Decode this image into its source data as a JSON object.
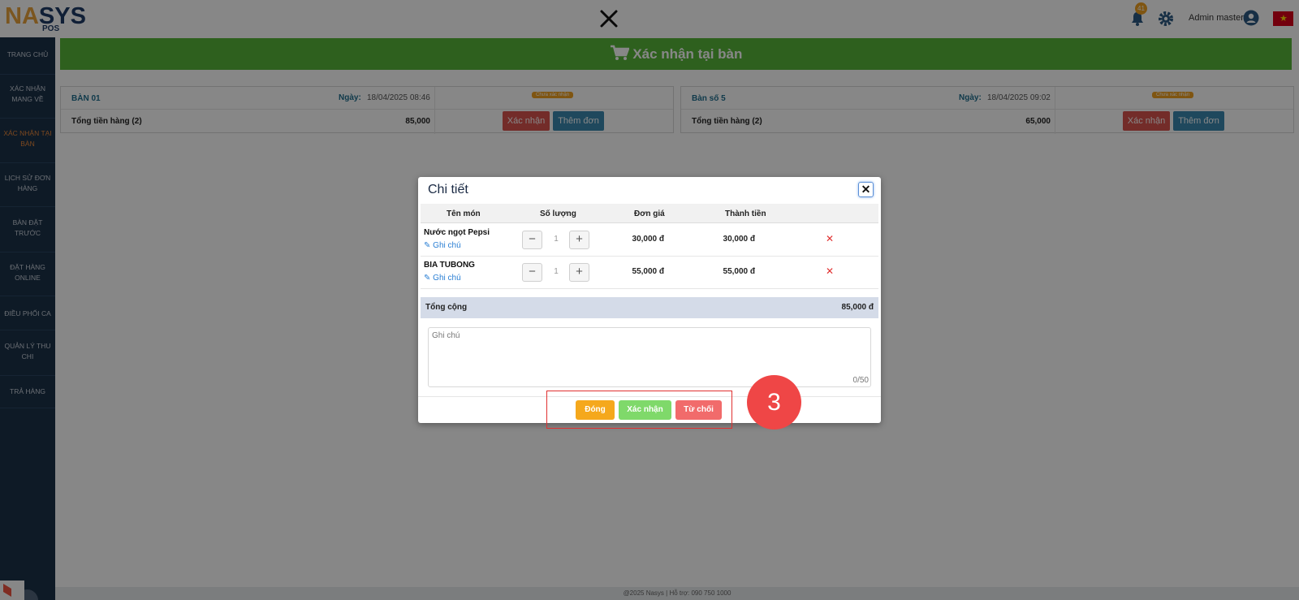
{
  "brand": {
    "logo_na": "NA",
    "logo_s": "S",
    "logo_ys": "YS",
    "logo_pos": "POS"
  },
  "header": {
    "notification_count": "41",
    "user_name": "Admin master",
    "flag": "★"
  },
  "sidebar": {
    "items": [
      {
        "label": "TRANG CHỦ"
      },
      {
        "label": "XÁC NHẬN MANG VỀ"
      },
      {
        "label": "XÁC NHẬN TẠI BÀN",
        "active": true
      },
      {
        "label": "LỊCH SỬ ĐƠN HÀNG"
      },
      {
        "label": "BÀN ĐẶT TRƯỚC"
      },
      {
        "label": "ĐẶT HÀNG ONLINE"
      },
      {
        "label": "ĐIỀU PHỐI CA"
      },
      {
        "label": "QUẢN LÝ THU CHI"
      },
      {
        "label": "TRẢ HÀNG"
      }
    ],
    "back_icon": "←"
  },
  "banner": {
    "title": "Xác nhận tại bàn"
  },
  "cards": [
    {
      "table": "BÀN 01",
      "date_label": "Ngày:",
      "date": "18/04/2025 08:46",
      "status": "Chưa xác nhận",
      "total_label": "Tổng tiền hàng (2)",
      "total": "85,000",
      "confirm": "Xác nhận",
      "add": "Thêm đơn"
    },
    {
      "table": "Bàn số 5",
      "date_label": "Ngày:",
      "date": "18/04/2025 09:02",
      "status": "Chưa xác nhận",
      "total_label": "Tổng tiền hàng (2)",
      "total": "65,000",
      "confirm": "Xác nhận",
      "add": "Thêm đơn"
    }
  ],
  "footer": {
    "text": "@2025 Nasys | Hỗ trợ: 090 750 1000"
  },
  "modal": {
    "title": "Chi tiết",
    "close_glyph": "✕",
    "columns": [
      "Tên món",
      "Số lượng",
      "Đơn giá",
      "Thành tiền"
    ],
    "items": [
      {
        "name": "Nước ngọt Pepsi",
        "note": "Ghi chú",
        "qty": "1",
        "price": "30,000 đ",
        "amount": "30,000 đ"
      },
      {
        "name": "BIA TUBONG",
        "note": "Ghi chú",
        "qty": "1",
        "price": "55,000 đ",
        "amount": "55,000 đ"
      }
    ],
    "minus": "−",
    "plus": "+",
    "delete": "✕",
    "total_label": "Tổng cộng",
    "total_value": "85,000 đ",
    "note_placeholder": "Ghi chú",
    "note_counter": "0/50",
    "buttons": {
      "close": "Đóng",
      "accept": "Xác nhận",
      "reject": "Từ chối"
    }
  },
  "step_badge": "3",
  "colors": {
    "banner": "#57b63a",
    "sidebar": "#1c3149",
    "danger": "#d9534f",
    "info": "#3b88b0",
    "warning": "#f5a81c"
  }
}
